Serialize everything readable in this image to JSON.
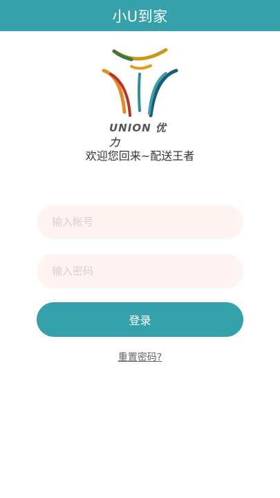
{
  "header": {
    "title": "小U到家"
  },
  "logo": {
    "icon": "union-youli-logo",
    "text": "UNION 优力"
  },
  "welcome": {
    "text": "欢迎您回来~配送王者"
  },
  "form": {
    "account_placeholder": "输入帐号",
    "password_placeholder": "输入密码",
    "login_label": "登录",
    "reset_label": "重置密码?"
  },
  "colors": {
    "primary": "#35a2ab",
    "field_bg": "#fff4f2"
  }
}
